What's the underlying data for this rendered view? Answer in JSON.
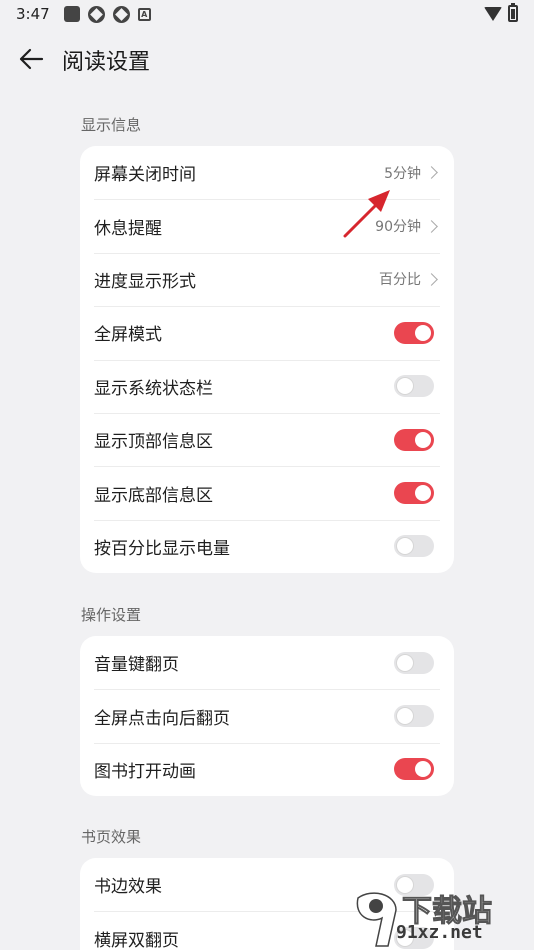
{
  "status_bar": {
    "time": "3:47"
  },
  "header": {
    "title": "阅读设置"
  },
  "sections": [
    {
      "label": "显示信息",
      "rows": [
        {
          "label": "屏幕关闭时间",
          "type": "nav",
          "value": "5分钟"
        },
        {
          "label": "休息提醒",
          "type": "nav",
          "value": "90分钟"
        },
        {
          "label": "进度显示形式",
          "type": "nav",
          "value": "百分比"
        },
        {
          "label": "全屏模式",
          "type": "toggle",
          "on": true
        },
        {
          "label": "显示系统状态栏",
          "type": "toggle",
          "on": false
        },
        {
          "label": "显示顶部信息区",
          "type": "toggle",
          "on": true
        },
        {
          "label": "显示底部信息区",
          "type": "toggle",
          "on": true
        },
        {
          "label": "按百分比显示电量",
          "type": "toggle",
          "on": false
        }
      ]
    },
    {
      "label": "操作设置",
      "rows": [
        {
          "label": "音量键翻页",
          "type": "toggle",
          "on": false
        },
        {
          "label": "全屏点击向后翻页",
          "type": "toggle",
          "on": false
        },
        {
          "label": "图书打开动画",
          "type": "toggle",
          "on": true
        }
      ]
    },
    {
      "label": "书页效果",
      "rows": [
        {
          "label": "书边效果",
          "type": "toggle",
          "on": false
        },
        {
          "label": "横屏双翻页",
          "type": "toggle",
          "on": false
        }
      ]
    }
  ],
  "colors": {
    "accent": "#ea4650",
    "annotation": "#d7262e",
    "background": "#f1f1f3"
  },
  "watermark": {
    "top": "下载站",
    "bottom": "91xz.net"
  }
}
